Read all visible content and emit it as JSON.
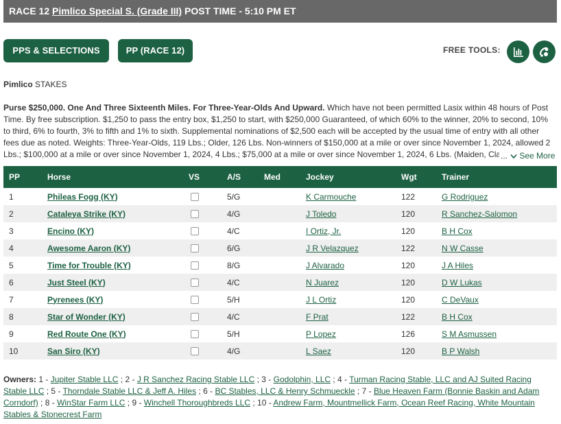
{
  "header": {
    "race_prefix": "RACE 12",
    "race_name": "Pimlico Special S. (Grade III)",
    "post_time": "POST TIME - 5:10 PM ET"
  },
  "buttons": {
    "pps_label": "PPS & SELECTIONS",
    "pp_label": "PP (RACE 12)",
    "free_tools_label": "FREE TOOLS:"
  },
  "icons": {
    "tool1": "bar-chart-icon",
    "tool2": "handicapping-tool-icon"
  },
  "track": {
    "name": "Pimlico",
    "type": "STAKES"
  },
  "conditions": {
    "lead": "Purse $250,000. One And Three Sixteenth Miles. For Three-Year-Olds And Upward.",
    "body": " Which have not been permitted Lasix within 48 hours of Post Time. By free subscription. $1,250 to pass the entry box, $1,250 to start, with $250,000 Guaranteed, of which 60% to the winner, 20% to second, 10% to third, 6% to fourth, 3% to fifth and 1% to sixth. Supplemental nominations of $2,500 each will be accepted by the usual time of entry with all other fees due as noted. Weights: Three-Year-Olds, 119 Lbs.; Older, 126 Lbs. Non-winners of $150,000 at a mile or over since November 1, 2024, allowed 2 Lbs.; $100,000 at a mile or over since November 1, 2024, 4 Lbs.; $75,000 at a mile or over since November 1, 2024, 6 Lbs. (Maiden, Claiming",
    "ellipsis": "...",
    "see_more": "See More"
  },
  "table": {
    "headers": [
      "PP",
      "Horse",
      "VS",
      "A/S",
      "Med",
      "Jockey",
      "Wgt",
      "Trainer"
    ],
    "rows": [
      {
        "pp": "1",
        "horse": "Phileas Fogg (KY)",
        "as": "5/G",
        "med": "",
        "jockey": "K Carmouche",
        "wgt": "122",
        "trainer": "G Rodriguez"
      },
      {
        "pp": "2",
        "horse": "Cataleya Strike (KY)",
        "as": "4/G",
        "med": "",
        "jockey": "J Toledo",
        "wgt": "120",
        "trainer": "R Sanchez-Salomon"
      },
      {
        "pp": "3",
        "horse": "Encino (KY)",
        "as": "4/C",
        "med": "",
        "jockey": "I Ortiz, Jr.",
        "wgt": "120",
        "trainer": "B H Cox"
      },
      {
        "pp": "4",
        "horse": "Awesome Aaron (KY)",
        "as": "6/G",
        "med": "",
        "jockey": "J R Velazquez",
        "wgt": "122",
        "trainer": "N W Casse"
      },
      {
        "pp": "5",
        "horse": "Time for Trouble (KY)",
        "as": "8/G",
        "med": "",
        "jockey": "J Alvarado",
        "wgt": "120",
        "trainer": "J A Hiles"
      },
      {
        "pp": "6",
        "horse": "Just Steel (KY)",
        "as": "4/C",
        "med": "",
        "jockey": "N Juarez",
        "wgt": "120",
        "trainer": "D W Lukas"
      },
      {
        "pp": "7",
        "horse": "Pyrenees (KY)",
        "as": "5/H",
        "med": "",
        "jockey": "J L Ortiz",
        "wgt": "120",
        "trainer": "C DeVaux"
      },
      {
        "pp": "8",
        "horse": "Star of Wonder (KY)",
        "as": "4/C",
        "med": "",
        "jockey": "F Prat",
        "wgt": "122",
        "trainer": "B H Cox"
      },
      {
        "pp": "9",
        "horse": "Red Route One (KY)",
        "as": "5/H",
        "med": "",
        "jockey": "P Lopez",
        "wgt": "126",
        "trainer": "S M Asmussen"
      },
      {
        "pp": "10",
        "horse": "San Siro (KY)",
        "as": "4/G",
        "med": "",
        "jockey": "L Saez",
        "wgt": "120",
        "trainer": "B P Walsh"
      }
    ]
  },
  "owners": {
    "label": "Owners:",
    "items": [
      {
        "num": "1",
        "name": "Jupiter Stable LLC"
      },
      {
        "num": "2",
        "name": "J R Sanchez Racing Stable LLC"
      },
      {
        "num": "3",
        "name": "Godolphin, LLC"
      },
      {
        "num": "4",
        "name": "Turman Racing Stable, LLC and AJ Suited Racing Stable LLC"
      },
      {
        "num": "5",
        "name": "Thorndale Stable LLC & Jeff A. Hiles"
      },
      {
        "num": "6",
        "name": "BC Stables, LLC & Henry Schmueckle"
      },
      {
        "num": "7",
        "name": "Blue Heaven Farm (Bonnie Baskin and Adam Corndorf)"
      },
      {
        "num": "8",
        "name": "WinStar Farm LLC"
      },
      {
        "num": "9",
        "name": "Winchell Thoroughbreds LLC"
      },
      {
        "num": "10",
        "name": "Andrew Farm, Mountmellick Farm, Ocean Reef Racing, White Mountain Stables & Stonecrest Farm"
      }
    ]
  },
  "colors": {
    "brand_green": "#1d6143",
    "header_gray": "#686868",
    "row_stripe": "#efefef"
  }
}
